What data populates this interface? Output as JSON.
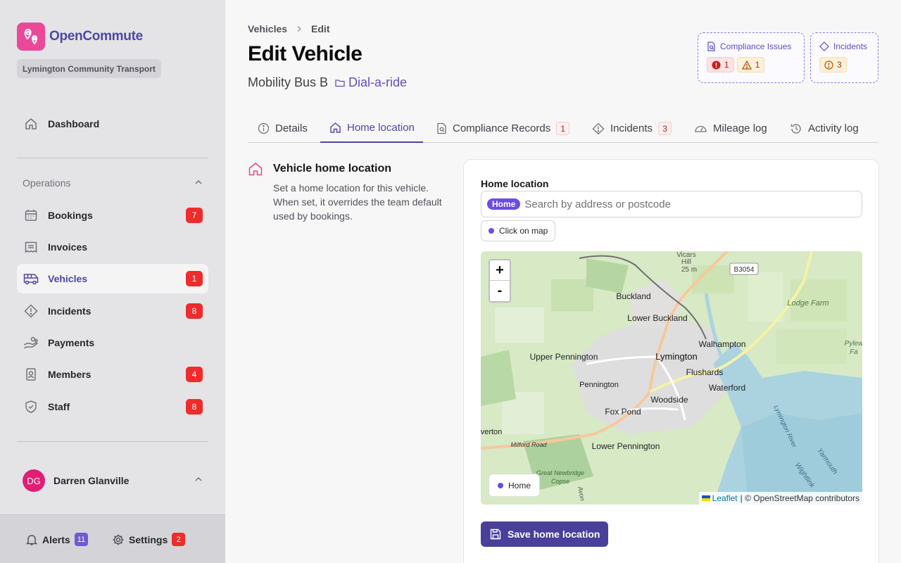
{
  "app": {
    "name": "OpenCommute",
    "organisation": "Lymington Community Transport"
  },
  "sidebar": {
    "top_items": [
      {
        "label": "Dashboard",
        "icon": "home-icon"
      }
    ],
    "section_label": "Operations",
    "items": [
      {
        "label": "Bookings",
        "icon": "calendar-icon",
        "badge": "7"
      },
      {
        "label": "Invoices",
        "icon": "receipt-icon",
        "badge": ""
      },
      {
        "label": "Vehicles",
        "icon": "bus-icon",
        "badge": "1",
        "active": true
      },
      {
        "label": "Incidents",
        "icon": "warning-diamond-icon",
        "badge": "8"
      },
      {
        "label": "Payments",
        "icon": "hand-coins-icon",
        "badge": ""
      },
      {
        "label": "Members",
        "icon": "id-badge-icon",
        "badge": "4"
      },
      {
        "label": "Staff",
        "icon": "shield-check-icon",
        "badge": "8"
      }
    ],
    "user": {
      "initials": "DG",
      "name": "Darren Glanville"
    },
    "footer": {
      "alerts_label": "Alerts",
      "alerts_count": "11",
      "settings_label": "Settings",
      "settings_count": "2"
    }
  },
  "header": {
    "breadcrumb": [
      "Vehicles",
      "Edit"
    ],
    "title": "Edit Vehicle",
    "vehicle_name": "Mobility Bus B",
    "vehicle_tag": "Dial-a-ride",
    "compliance_card": {
      "title": "Compliance Issues",
      "errors": "1",
      "warnings": "1"
    },
    "incidents_card": {
      "title": "Incidents",
      "count": "3"
    }
  },
  "tabs": [
    {
      "label": "Details",
      "count": ""
    },
    {
      "label": "Home location",
      "count": "",
      "active": true
    },
    {
      "label": "Compliance Records",
      "count": "1"
    },
    {
      "label": "Incidents",
      "count": "3"
    },
    {
      "label": "Mileage log",
      "count": ""
    },
    {
      "label": "Activity log",
      "count": ""
    }
  ],
  "section": {
    "title": "Vehicle home location",
    "description": "Set a home location for this vehicle. When set, it overrides the team default used by bookings."
  },
  "form": {
    "field_label": "Home location",
    "chip": "Home",
    "search_placeholder": "Search by address or postcode",
    "click_on_map": "Click on map",
    "save_label": "Save home location"
  },
  "map": {
    "zoom_in": "+",
    "zoom_out": "-",
    "legend": "Home",
    "attribution_link": "Leaflet",
    "attribution_text": "| © OpenStreetMap contributors",
    "labels": [
      "Vicars Hill",
      "25 m",
      "B3054",
      "Buckland",
      "Lodge Farm",
      "Lower Buckland",
      "Walhampton",
      "Pylew Fa",
      "Upper Pennington",
      "Lymington",
      "Flushards",
      "Waterford",
      "Pennington",
      "Woodside",
      "Fox Pond",
      "verton",
      "Milford Road",
      "Lower Pennington",
      "Lymington River",
      "Yarmouth",
      "Wightlink",
      "Great Newbridge Copse",
      "Avon"
    ]
  },
  "colors": {
    "accent": "#4f46a5",
    "brand": "#ec4899",
    "badge_red": "#ef2b2b",
    "home_chip": "#6d4be0"
  }
}
